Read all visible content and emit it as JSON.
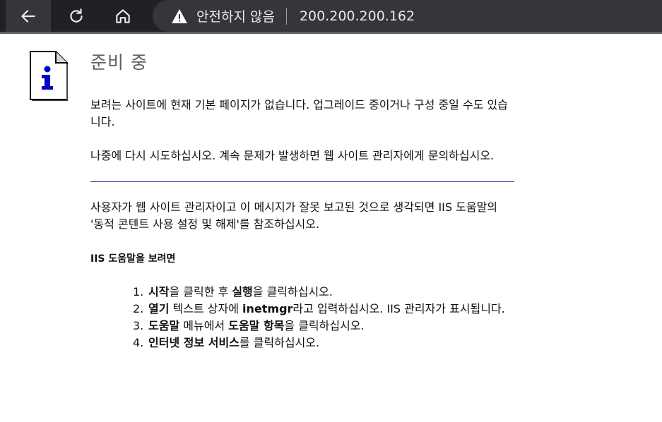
{
  "browser": {
    "security_label": "안전하지 않음",
    "url": "200.200.200.162",
    "icons": {
      "back": "back-arrow-icon",
      "reload": "reload-icon",
      "home": "home-icon",
      "warning": "warning-triangle-icon"
    }
  },
  "page": {
    "title": "준비 중",
    "paragraph1": "보려는 사이트에 현재 기본 페이지가 없습니다. 업그레이드 중이거나 구성 중일 수도 있습니다.",
    "paragraph2": "나중에 다시 시도하십시오. 계속 문제가 발생하면 웹 사이트 관리자에게 문의하십시오.",
    "paragraph3": "사용자가 웹 사이트 관리자이고 이 메시지가 잘못 보고된 것으로 생각되면 IIS 도움말의 '동적 콘텐트 사용 설정 및 해제'를 참조하십시오.",
    "subheading": "IIS 도움말을 보려면",
    "steps": [
      {
        "num": "1.",
        "bold1": "시작",
        "text1": "을 클릭한 후 ",
        "bold2": "실행",
        "text2": "을 클릭하십시오."
      },
      {
        "num": "2.",
        "bold1": "열기",
        "text1": " 텍스트 상자에 ",
        "bold2": "inetmgr",
        "text2": "라고 입력하십시오. IIS 관리자가 표시됩니다."
      },
      {
        "num": "3.",
        "bold1": "도움말",
        "text1": " 메뉴에서 ",
        "bold2": "도움말 항목",
        "text2": "을 클릭하십시오."
      },
      {
        "num": "4.",
        "bold1": "인터넷 정보 서비스",
        "text1": "를 클릭하십시오.",
        "bold2": "",
        "text2": ""
      }
    ]
  },
  "colors": {
    "toolbar_bg": "#202124",
    "omnibox_bg": "#35363a",
    "rule": "#3a3a9a",
    "info_icon_blue": "#0000cc"
  }
}
